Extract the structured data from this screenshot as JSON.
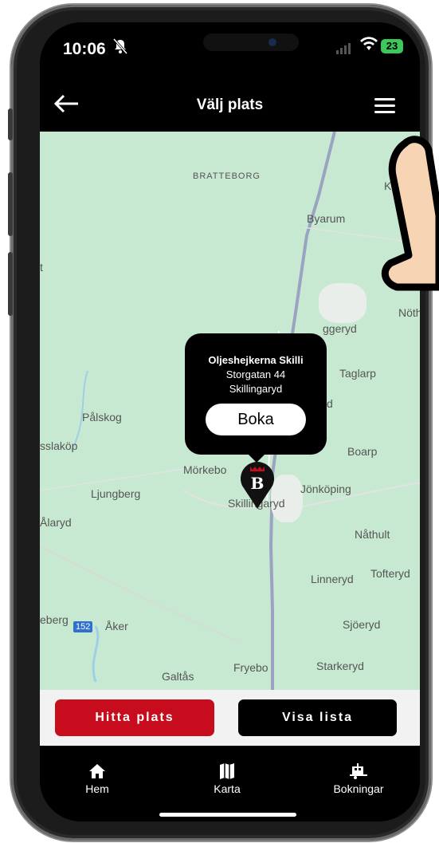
{
  "status": {
    "time": "10:06",
    "battery": "23"
  },
  "header": {
    "title": "Välj plats"
  },
  "map": {
    "labels": {
      "bratteborg": "BRATTEBORG",
      "kranges": "Kränge",
      "byarum": "Byarum",
      "t": "t",
      "nothu": "Nöthu",
      "ggeryd": "ggeryd",
      "taglarp": "Taglarp",
      "d": "d",
      "palskog": "Pålskog",
      "sslakop": "sslaköp",
      "boarp": "Boarp",
      "morkebo": "Mörkebo",
      "jonkoping": "Jönköping",
      "ljungberg": "Ljungberg",
      "skillingaryd": "Skillingaryd",
      "alaryd": "Ålaryd",
      "nathult": "Nåthult",
      "linneryd": "Linneryd",
      "tofteryd": "Tofteryd",
      "eberg": "eberg",
      "route": "152",
      "aker": "Åker",
      "sjoeryd": "Sjöeryd",
      "galtas": "Galtås",
      "fryebo": "Fryebo",
      "starkeryd": "Starkeryd"
    }
  },
  "popup": {
    "name": "Oljeshejkerna Skilli",
    "street": "Storgatan 44",
    "city": "Skillingaryd",
    "book_label": "Boka"
  },
  "pin": {
    "letter": "B"
  },
  "actions": {
    "find_label": "Hitta plats",
    "list_label": "Visa lista"
  },
  "tabs": {
    "home": "Hem",
    "map": "Karta",
    "bookings": "Bokningar"
  },
  "colors": {
    "accent_red": "#c70d1d",
    "map_green": "#c8e9d1",
    "bar_black": "#000000"
  }
}
